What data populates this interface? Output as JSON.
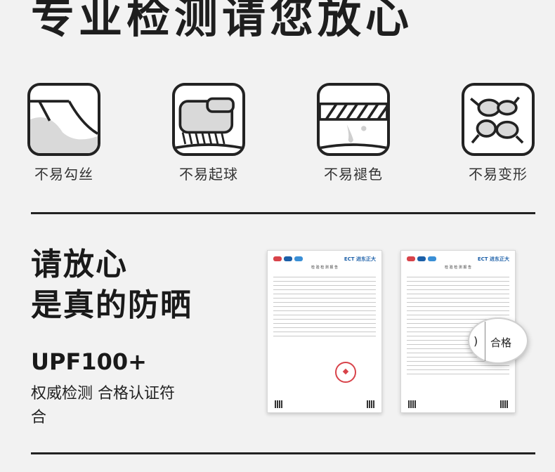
{
  "hero": {
    "title": "专业检测请您放心"
  },
  "features": [
    {
      "label": "不易勾丝",
      "icon": "snag-resist-icon"
    },
    {
      "label": "不易起球",
      "icon": "pilling-resist-icon"
    },
    {
      "label": "不易褪色",
      "icon": "fade-resist-icon"
    },
    {
      "label": "不易变形",
      "icon": "deform-resist-icon"
    }
  ],
  "claim": {
    "line1": "请放心",
    "line2": "是真的防晒",
    "upf": "UPF100+",
    "desc": "权威检测 合格认证符合"
  },
  "reports": [
    {
      "brand": "ECT 进东正大",
      "title": "检 验 检 测 报 告"
    },
    {
      "brand": "ECT 进东正大",
      "title": "检 验 检 测 报 告"
    }
  ],
  "magnifier": {
    "fragment": ")",
    "text": "合格"
  },
  "colors": {
    "ink": "#1e1e1e",
    "background": "#f2f2f2",
    "accent_blue": "#1b5fa8",
    "stamp_red": "#d8434a"
  }
}
